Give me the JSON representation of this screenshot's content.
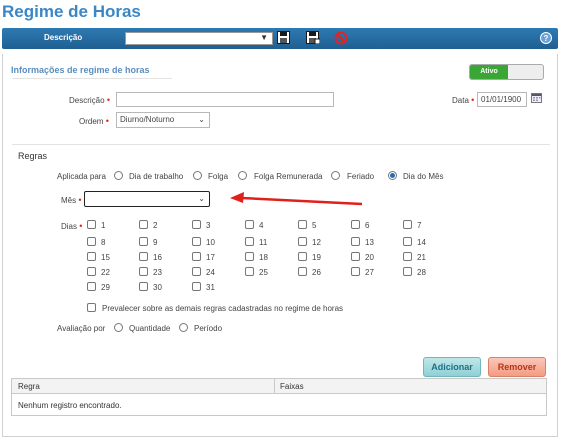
{
  "page": {
    "title": "Regime de Horas"
  },
  "toolbar": {
    "descricao_label": "Descrição",
    "descricao_value": "",
    "help": "?"
  },
  "info": {
    "section_title": "Informações de regime de horas",
    "status": "Ativo",
    "descricao_label": "Descrição",
    "descricao_value": "",
    "data_label": "Data",
    "data_value": "01/01/1900",
    "ordem_label": "Ordem",
    "ordem_value": "Diurno/Noturno"
  },
  "regras": {
    "title": "Regras",
    "aplicada_label": "Aplicada para",
    "options": [
      {
        "label": "Dia de trabalho",
        "checked": false
      },
      {
        "label": "Folga",
        "checked": false
      },
      {
        "label": "Folga Remunerada",
        "checked": false
      },
      {
        "label": "Feriado",
        "checked": false
      },
      {
        "label": "Dia do Mês",
        "checked": true
      }
    ],
    "mes_label": "Mês",
    "mes_value": "",
    "dias_label": "Dias",
    "dias": [
      "1",
      "2",
      "3",
      "4",
      "5",
      "6",
      "7",
      "8",
      "9",
      "10",
      "11",
      "12",
      "13",
      "14",
      "15",
      "16",
      "17",
      "18",
      "19",
      "20",
      "21",
      "22",
      "23",
      "24",
      "25",
      "26",
      "27",
      "28",
      "29",
      "30",
      "31"
    ],
    "prevalecer_label": "Prevalecer sobre as demais regras cadastradas no regime de horas",
    "avaliacao_label": "Avaliação por",
    "avaliacao_options": [
      {
        "label": "Quantidade",
        "checked": false
      },
      {
        "label": "Período",
        "checked": false
      }
    ]
  },
  "buttons": {
    "adicionar": "Adicionar",
    "remover": "Remover"
  },
  "table": {
    "columns": [
      "Regra",
      "Faixas"
    ],
    "empty_message": "Nenhum registro encontrado."
  },
  "colors": {
    "accent": "#3a87c8",
    "toolbar": "#2e7ab3",
    "active": "#3aa635",
    "arrow": "#e0201a"
  }
}
